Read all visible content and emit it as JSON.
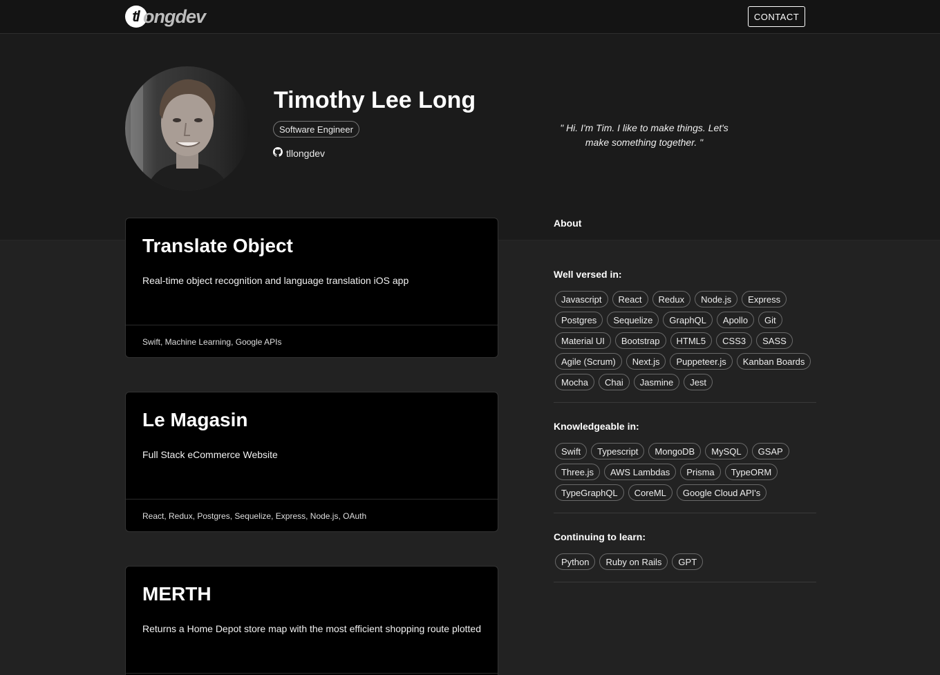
{
  "nav": {
    "logo_badge": "tl",
    "logo_text": "ongdev",
    "contact_label": "CONTACT"
  },
  "profile": {
    "name": "Timothy Lee Long",
    "role": "Software Engineer",
    "github_handle": "tllongdev",
    "quote": "\" Hi. I'm Tim. I like to make things. Let's make something together. \""
  },
  "projects": [
    {
      "title": "Translate Object",
      "description": "Real-time object recognition and language translation iOS app",
      "tech": "Swift, Machine Learning, Google APIs"
    },
    {
      "title": "Le Magasin",
      "description": "Full Stack eCommerce Website",
      "tech": "React, Redux, Postgres, Sequelize, Express, Node.js, OAuth"
    },
    {
      "title": "MERTH",
      "description": "Returns a Home Depot store map with the most efficient shopping route plotted",
      "tech": ""
    }
  ],
  "about": {
    "tab_label": "About",
    "sections": [
      {
        "heading": "Well versed in:",
        "skills": [
          "Javascript",
          "React",
          "Redux",
          "Node.js",
          "Express",
          "Postgres",
          "Sequelize",
          "GraphQL",
          "Apollo",
          "Git",
          "Material UI",
          "Bootstrap",
          "HTML5",
          "CSS3",
          "SASS",
          "Agile (Scrum)",
          "Next.js",
          "Puppeteer.js",
          "Kanban Boards",
          "Mocha",
          "Chai",
          "Jasmine",
          "Jest"
        ]
      },
      {
        "heading": "Knowledgeable in:",
        "skills": [
          "Swift",
          "Typescript",
          "MongoDB",
          "MySQL",
          "GSAP",
          "Three.js",
          "AWS Lambdas",
          "Prisma",
          "TypeORM",
          "TypeGraphQL",
          "CoreML",
          "Google Cloud API's"
        ]
      },
      {
        "heading": "Continuing to learn:",
        "skills": [
          "Python",
          "Ruby on Rails",
          "GPT"
        ]
      }
    ]
  },
  "colors": {
    "background": "#222222",
    "hero_background": "#1b1b1b",
    "navbar": "#141414",
    "card": "#000000",
    "text": "#ffffff"
  }
}
